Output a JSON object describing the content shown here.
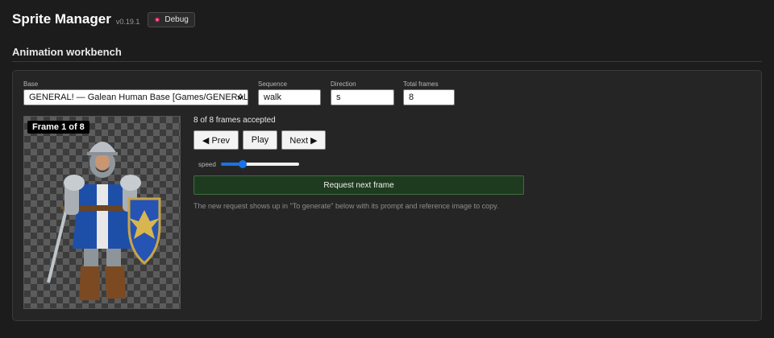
{
  "app": {
    "title": "Sprite Manager",
    "version": "v0.19.1",
    "debug_label": "Debug",
    "debug_icon": "bug-icon"
  },
  "section": {
    "title": "Animation workbench"
  },
  "form": {
    "base": {
      "label": "Base",
      "selected": "GENERAL! — Galean Human Base [Games/GENERAL!]"
    },
    "sequence": {
      "label": "Sequence",
      "value": "walk"
    },
    "direction": {
      "label": "Direction",
      "value": "s"
    },
    "total_frames": {
      "label": "Total frames",
      "value": "8"
    }
  },
  "preview": {
    "frame_badge": "Frame 1 of 8",
    "sprite": "knight-sprite"
  },
  "playback": {
    "status": "8 of 8 frames accepted",
    "prev_label": "◀ Prev",
    "play_label": "Play",
    "next_label": "Next ▶",
    "speed_label": "speed",
    "speed_value": 0.28
  },
  "request": {
    "button_label": "Request next frame",
    "hint": "The new request shows up in \"To generate\" below with its prompt and reference image to copy."
  },
  "colors": {
    "background": "#1c1c1c",
    "panel": "#252525",
    "accent": "#1a73e8",
    "request_button": "#1f3b1f"
  }
}
